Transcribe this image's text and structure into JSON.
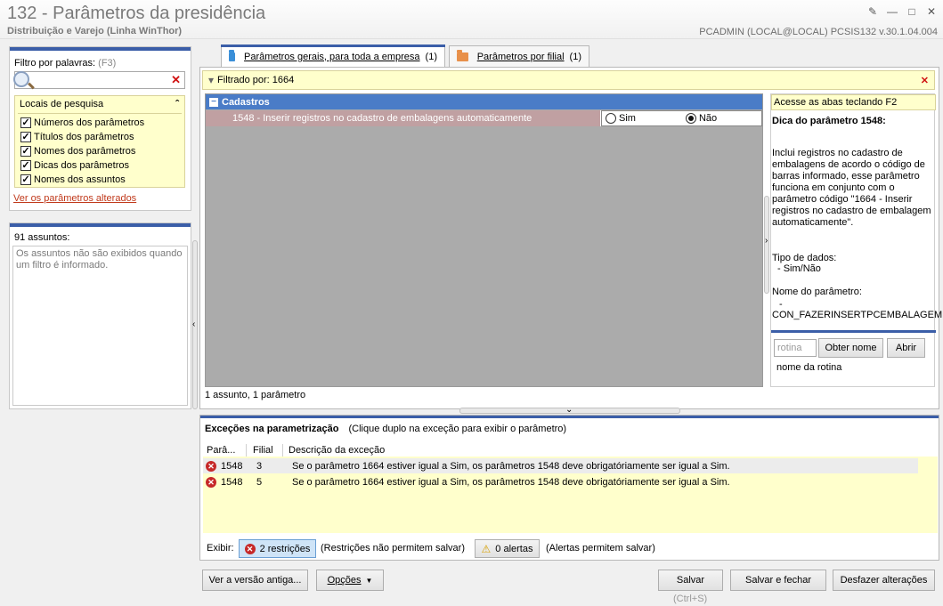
{
  "window": {
    "title": "132 - Parâmetros da presidência",
    "subtitle": "Distribuição e Varejo (Linha WinThor)",
    "user_info": "PCADMIN (LOCAL@LOCAL)   PCSIS132  v.30.1.04.004"
  },
  "filter_panel": {
    "label": "Filtro por palavras:",
    "shortcut": "(F3)",
    "search_value": "",
    "locais_title": "Locais de pesquisa",
    "locais": [
      {
        "label": "Números dos parâmetros",
        "checked": true
      },
      {
        "label": "Títulos dos parâmetros",
        "checked": true
      },
      {
        "label": "Nomes dos parâmetros",
        "checked": true
      },
      {
        "label": "Dicas dos parâmetros",
        "checked": true
      },
      {
        "label": "Nomes dos assuntos",
        "checked": true
      }
    ],
    "changed_link": "Ver os parâmetros alterados"
  },
  "subjects_panel": {
    "title": "91 assuntos:",
    "info": "Os assuntos não são exibidos quando um filtro é informado."
  },
  "tabs": [
    {
      "label": "Parâmetros gerais, para toda a empresa",
      "count": "(1)",
      "active": true,
      "color": "#3a8fd8"
    },
    {
      "label": "Parâmetros por filial",
      "count": "(1)",
      "active": false,
      "color": "#e8904a"
    }
  ],
  "filter_bar": {
    "text": "Filtrado por: 1664"
  },
  "params": {
    "group": "Cadastros",
    "row_label": "1548 - Inserir registros no cadastro de embalagens automaticamente",
    "opt_yes": "Sim",
    "opt_no": "Não",
    "selected": "Não",
    "status": "1 assunto, 1 parâmetro"
  },
  "help": {
    "hint": "Acesse as abas teclando F2",
    "title": "Dica do parâmetro 1548:",
    "desc": "Inclui registros no cadastro de embalagens de acordo o código de barras informado, esse parâmetro funciona em conjunto com o parâmetro código \"1664 - Inserir registros no cadastro de embalagem automaticamente\".",
    "type_label": "Tipo de dados:",
    "type_value": "- Sim/Não",
    "name_label": "Nome do parâmetro:",
    "name_dash": "-",
    "name_value": "CON_FAZERINSERTPCEMBALAGEM",
    "lookup_placeholder": "rotina",
    "get_name_button": "Obter nome",
    "open_button": "Abrir",
    "routine_name": "nome da rotina"
  },
  "exceptions": {
    "title": "Exceções na parametrização",
    "subtitle": "(Clique duplo na exceção para exibir o parâmetro)",
    "columns": [
      "Parâ...",
      "Filial",
      "Descrição da exceção"
    ],
    "rows": [
      {
        "param": "1548",
        "filial": "3",
        "desc": "Se o parâmetro 1664 estiver igual a Sim, os parâmetros 1548 deve obrigatóriamente ser igual a Sim."
      },
      {
        "param": "1548",
        "filial": "5",
        "desc": "Se o parâmetro 1664 estiver igual a Sim, os parâmetros 1548 deve obrigatóriamente ser igual a Sim."
      }
    ],
    "show_label": "Exibir:",
    "restrictions_button": "2 restrições",
    "restrictions_note": "(Restrições não permitem salvar)",
    "alerts_button": "0 alertas",
    "alerts_note": "(Alertas permitem salvar)"
  },
  "footer": {
    "old_version_button": "Ver a versão antiga...",
    "options_button": "Opções",
    "save_button": "Salvar",
    "save_shortcut": "(Ctrl+S)",
    "save_close_button": "Salvar e fechar",
    "undo_button": "Desfazer alterações"
  }
}
